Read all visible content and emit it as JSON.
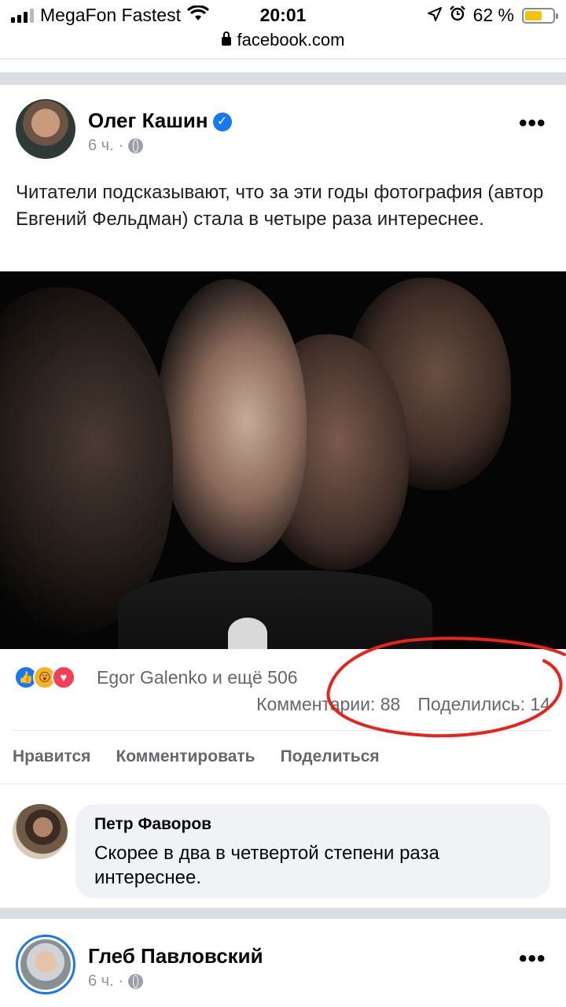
{
  "status_bar": {
    "carrier": "MegaFon Fastest",
    "time": "20:01",
    "battery": "62 %",
    "battery_level": 0.62
  },
  "browser": {
    "url": "facebook.com"
  },
  "post": {
    "author": "Олег Кашин",
    "verified": true,
    "time": "6 ч.",
    "text": "Читатели подсказывают, что за эти годы фотография (автор Евгений Фельдман) стала в четыре раза интереснее.",
    "reactions": [
      "like",
      "wow",
      "love"
    ],
    "reactions_summary": "Egor Galenko и ещё 506",
    "comments": "Комментарии: 88",
    "shares": "Поделились: 14",
    "actions": {
      "like": "Нравится",
      "comment": "Комментировать",
      "share": "Поделиться"
    }
  },
  "comment": {
    "author": "Петр Фаворов",
    "text": "Скорее в два в четвертой степени раза интереснее."
  },
  "next_post": {
    "author": "Глеб Павловский",
    "time": "6 ч."
  },
  "colors": {
    "accent": "#1877f2",
    "annotation": "#e8231c"
  },
  "icons": [
    "signal-icon",
    "wifi-icon",
    "location-icon",
    "alarm-icon",
    "battery-icon",
    "lock-icon",
    "verified-badge-icon",
    "globe-icon",
    "more-icon",
    "like-reaction-icon",
    "wow-reaction-icon",
    "love-reaction-icon"
  ]
}
